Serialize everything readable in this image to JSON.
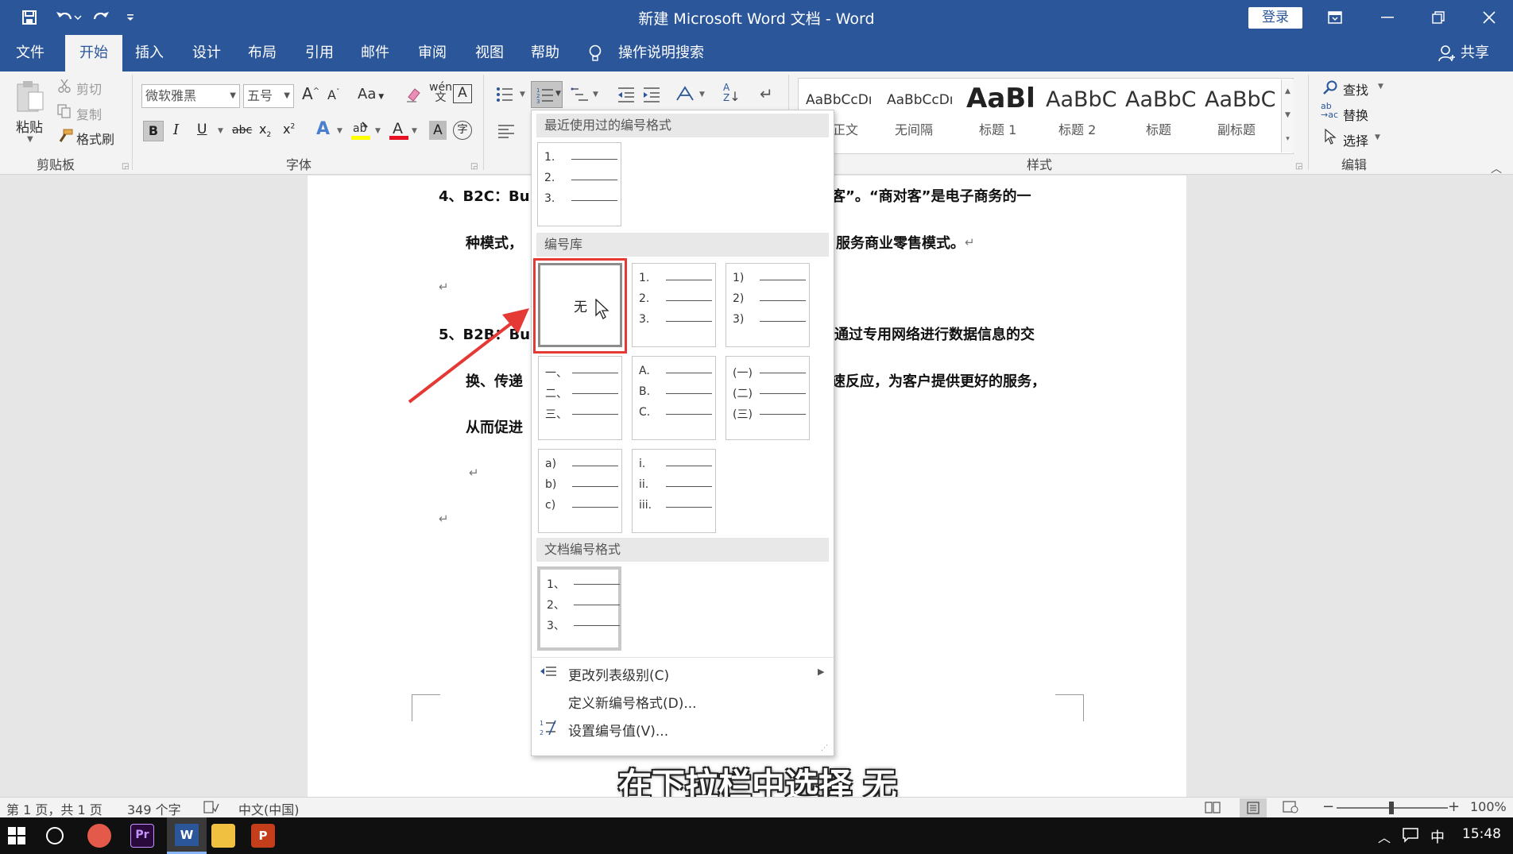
{
  "window": {
    "title": "新建 Microsoft Word 文档  -  Word",
    "login_label": "登录",
    "share_label": "共享"
  },
  "tabs": [
    "文件",
    "开始",
    "插入",
    "设计",
    "布局",
    "引用",
    "邮件",
    "审阅",
    "视图",
    "帮助"
  ],
  "tell_me": "操作说明搜索",
  "ribbon": {
    "clipboard": {
      "paste": "粘贴",
      "cut": "剪切",
      "copy": "复制",
      "format_painter": "格式刷",
      "group": "剪贴板"
    },
    "font": {
      "font_name": "微软雅黑",
      "font_size": "五号",
      "group": "字体",
      "aa": "Aa"
    },
    "styles": {
      "group": "样式",
      "items": [
        {
          "preview": "AaBbCcDı",
          "label": "正文"
        },
        {
          "preview": "AaBbCcDı",
          "label": "无间隔"
        },
        {
          "preview": "AaBl",
          "label": "标题 1"
        },
        {
          "preview": "AaBbC",
          "label": "标题 2"
        },
        {
          "preview": "AaBbC",
          "label": "标题"
        },
        {
          "preview": "AaBbC",
          "label": "副标题"
        }
      ]
    },
    "editing": {
      "find": "查找",
      "replace": "替换",
      "select": "选择",
      "group": "编辑"
    }
  },
  "document": {
    "line1_start": "4、B2C：Bu",
    "line1_end": "客”。“商对客”是电子商务的一",
    "line2_start": "种模式，",
    "line2_end": "服务商业零售模式。",
    "line3_start": "5、B2B：Bu",
    "line3_end": "通过专用网络进行数据信息的交",
    "line4_start": "换、传递",
    "line4_end": "速反应，为客户提供更好的服务，",
    "line5_start": "从而促进",
    "para_mark": "↵"
  },
  "dropdown": {
    "recent_header": "最近使用过的编号格式",
    "library_header": "编号库",
    "doc_header": "文档编号格式",
    "none_label": "无",
    "recent": [
      [
        "1.",
        "2.",
        "3."
      ]
    ],
    "library": [
      [
        "1.",
        "2.",
        "3."
      ],
      [
        "1)",
        "2)",
        "3)"
      ],
      [
        "一、",
        "二、",
        "三、"
      ],
      [
        "A.",
        "B.",
        "C."
      ],
      [
        "(一)",
        "(二)",
        "(三)"
      ],
      [
        "a)",
        "b)",
        "c)"
      ],
      [
        "i.",
        "ii.",
        "iii."
      ]
    ],
    "doc_formats": [
      [
        "1、",
        "2、",
        "3、"
      ]
    ],
    "menu": [
      "更改列表级别(C)",
      "定义新编号格式(D)...",
      "设置编号值(V)..."
    ]
  },
  "statusbar": {
    "page": "第 1 页，共 1 页",
    "words": "349 个字",
    "language": "中文(中国)",
    "zoom": "100%"
  },
  "taskbar": {
    "ime": "中",
    "time": "15:48"
  },
  "caption": "在下拉栏中选择 无",
  "colors": {
    "word_blue": "#2b579a",
    "highlight_red": "#e53935",
    "font_red": "#e81123"
  }
}
